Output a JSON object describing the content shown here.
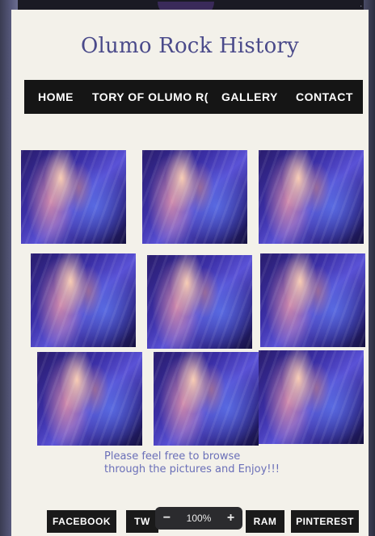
{
  "browser": {
    "top_right_text": ". . ."
  },
  "site": {
    "title": "Olumo Rock History"
  },
  "nav": {
    "home": "HOME",
    "story": "TORY OF OLUMO R(",
    "gallery": "GALLERY",
    "contact": "CONTACT"
  },
  "gallery": {
    "thumbnail_icon": "canyon-photo",
    "rows": 3,
    "columns": 3
  },
  "browse_message": {
    "line1": "Please feel free to browse",
    "line2": "through the pictures and Enjoy!!!"
  },
  "social": {
    "facebook": "FACEBOOK",
    "twitter": "TW",
    "instagram": "RAM",
    "pinterest": "PINTEREST"
  },
  "zoom": {
    "minus": "−",
    "level": "100%",
    "plus": "+"
  },
  "colors": {
    "page_bg": "#f3f1ea",
    "nav_bg": "#151515",
    "title": "#4a4a8a",
    "message": "#6a6fb8"
  }
}
